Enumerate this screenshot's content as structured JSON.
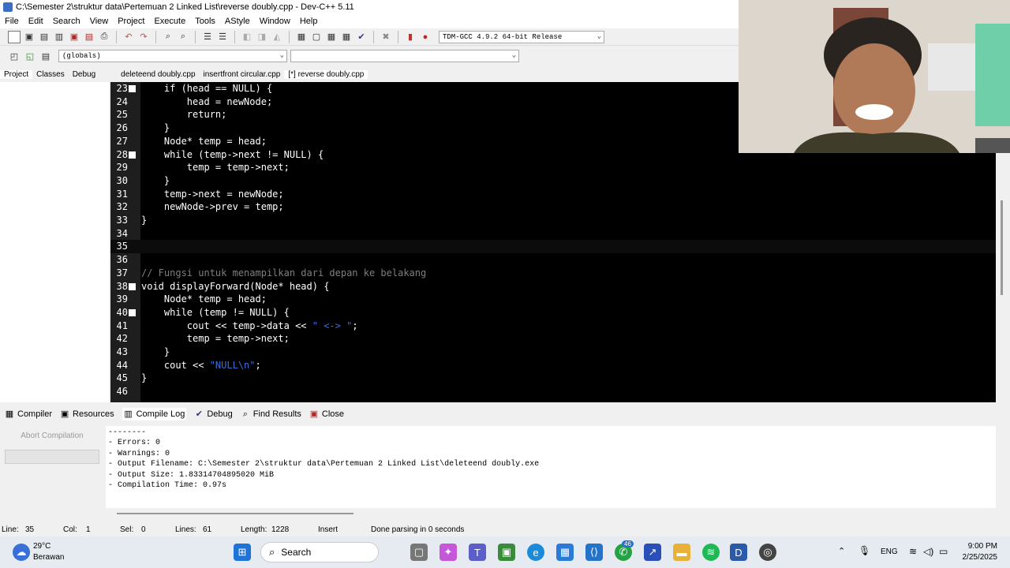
{
  "window": {
    "title": "C:\\Semester 2\\struktur data\\Pertemuan 2 Linked List\\reverse doubly.cpp - Dev-C++ 5.11"
  },
  "menu": [
    "File",
    "Edit",
    "Search",
    "View",
    "Project",
    "Execute",
    "Tools",
    "AStyle",
    "Window",
    "Help"
  ],
  "toolbar": {
    "compiler_select": "TDM-GCC 4.9.2 64-bit Release",
    "scope_select": "(globals)",
    "function_select": ""
  },
  "panel_tabs": [
    "Project",
    "Classes",
    "Debug"
  ],
  "file_tabs": [
    "deleteend doubly.cpp",
    "insertfront circular.cpp",
    "[*] reverse doubly.cpp"
  ],
  "code": [
    {
      "n": "23",
      "fold": true,
      "text": "    if (head == NULL) {"
    },
    {
      "n": "24",
      "fold": false,
      "text": "        head = newNode;"
    },
    {
      "n": "25",
      "fold": false,
      "text": "        return;"
    },
    {
      "n": "26",
      "fold": false,
      "text": "    }"
    },
    {
      "n": "27",
      "fold": false,
      "text": "    Node* temp = head;"
    },
    {
      "n": "28",
      "fold": true,
      "text": "    while (temp->next != NULL) {"
    },
    {
      "n": "29",
      "fold": false,
      "text": "        temp = temp->next;"
    },
    {
      "n": "30",
      "fold": false,
      "text": "    }"
    },
    {
      "n": "31",
      "fold": false,
      "text": "    temp->next = newNode;"
    },
    {
      "n": "32",
      "fold": false,
      "text": "    newNode->prev = temp;"
    },
    {
      "n": "33",
      "fold": false,
      "text": "}"
    },
    {
      "n": "34",
      "fold": false,
      "text": ""
    },
    {
      "n": "35",
      "fold": false,
      "text": ""
    },
    {
      "n": "36",
      "fold": false,
      "text": ""
    },
    {
      "n": "37",
      "fold": false,
      "text": "// Fungsi untuk menampilkan dari depan ke belakang"
    },
    {
      "n": "38",
      "fold": true,
      "text": "void displayForward(Node* head) {"
    },
    {
      "n": "39",
      "fold": false,
      "text": "    Node* temp = head;"
    },
    {
      "n": "40",
      "fold": true,
      "text": "    while (temp != NULL) {"
    },
    {
      "n": "41",
      "fold": false,
      "text": "        cout << temp->data << \" <-> \";"
    },
    {
      "n": "42",
      "fold": false,
      "text": "        temp = temp->next;"
    },
    {
      "n": "43",
      "fold": false,
      "text": "    }"
    },
    {
      "n": "44",
      "fold": false,
      "text": "    cout << \"NULL\\n\";"
    },
    {
      "n": "45",
      "fold": false,
      "text": "}"
    },
    {
      "n": "46",
      "fold": false,
      "text": ""
    }
  ],
  "bottom_tabs": [
    "Compiler",
    "Resources",
    "Compile Log",
    "Debug",
    "Find Results",
    "Close"
  ],
  "abort_button": "Abort Compilation",
  "compile_log": [
    "--------",
    "- Errors: 0",
    "- Warnings: 0",
    "- Output Filename: C:\\Semester 2\\struktur data\\Pertemuan 2 Linked List\\deleteend doubly.exe",
    "- Output Size: 1.83314704895020 MiB",
    "- Compilation Time: 0.97s"
  ],
  "status": {
    "line_label": "Line:",
    "line": "35",
    "col_label": "Col:",
    "col": "1",
    "sel_label": "Sel:",
    "sel": "0",
    "lines_label": "Lines:",
    "lines": "61",
    "length_label": "Length:",
    "length": "1228",
    "mode": "Insert",
    "message": "Done parsing in 0 seconds"
  },
  "taskbar": {
    "weather_temp": "29°C",
    "weather_desc": "Berawan",
    "search": "Search",
    "whatsapp_badge": "46",
    "lang": "ENG",
    "time": "9:00 PM",
    "date": "2/25/2025"
  }
}
